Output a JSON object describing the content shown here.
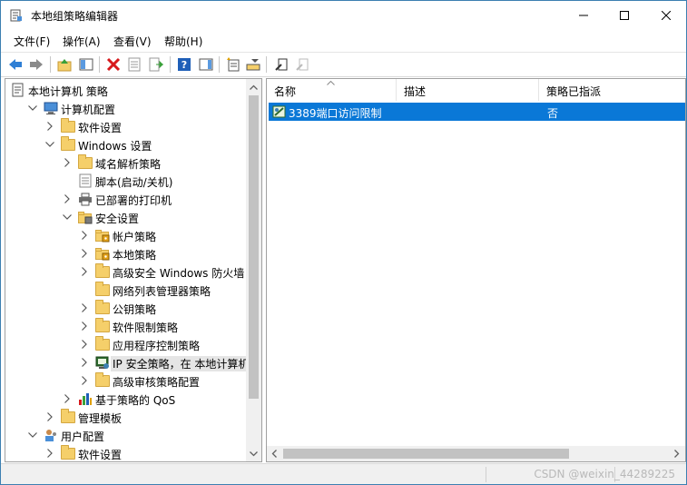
{
  "window": {
    "title": "本地组策略编辑器"
  },
  "menu": [
    {
      "label": "文件(F)"
    },
    {
      "label": "操作(A)"
    },
    {
      "label": "查看(V)"
    },
    {
      "label": "帮助(H)"
    }
  ],
  "toolbar": {
    "buttons": [
      {
        "icon": "back-arrow-icon"
      },
      {
        "icon": "forward-arrow-icon"
      },
      {
        "icon": "up-folder-icon"
      },
      {
        "icon": "show-hide-tree-icon"
      },
      {
        "icon": "delete-icon"
      },
      {
        "icon": "properties-icon"
      },
      {
        "icon": "export-list-icon"
      },
      {
        "icon": "help-icon"
      },
      {
        "icon": "action-pane-icon"
      },
      {
        "icon": "new-policy-icon"
      },
      {
        "icon": "manage-filters-icon"
      },
      {
        "icon": "assign-policy-icon"
      },
      {
        "icon": "unassign-policy-icon"
      }
    ]
  },
  "tree": [
    {
      "label": "本地计算机 策略",
      "icon": "policy-doc-icon",
      "expander": "none"
    },
    {
      "label": "计算机配置",
      "icon": "computer-icon",
      "expander": "expanded"
    },
    {
      "label": "软件设置",
      "icon": "folder-icon",
      "expander": "collapsed"
    },
    {
      "label": "Windows 设置",
      "icon": "folder-icon",
      "expander": "expanded"
    },
    {
      "label": "域名解析策略",
      "icon": "folder-icon",
      "expander": "collapsed"
    },
    {
      "label": "脚本(启动/关机)",
      "icon": "script-icon",
      "expander": "none"
    },
    {
      "label": "已部署的打印机",
      "icon": "printer-icon",
      "expander": "collapsed"
    },
    {
      "label": "安全设置",
      "icon": "security-folder-icon",
      "expander": "expanded"
    },
    {
      "label": "帐户策略",
      "icon": "lock-folder-icon",
      "expander": "collapsed"
    },
    {
      "label": "本地策略",
      "icon": "lock-folder-icon",
      "expander": "collapsed"
    },
    {
      "label": "高级安全 Windows 防火墙",
      "icon": "folder-icon",
      "expander": "collapsed"
    },
    {
      "label": "网络列表管理器策略",
      "icon": "folder-icon",
      "expander": "none"
    },
    {
      "label": "公钥策略",
      "icon": "folder-icon",
      "expander": "collapsed"
    },
    {
      "label": "软件限制策略",
      "icon": "folder-icon",
      "expander": "collapsed"
    },
    {
      "label": "应用程序控制策略",
      "icon": "folder-icon",
      "expander": "collapsed"
    },
    {
      "label": "IP 安全策略，在 本地计算机",
      "icon": "ipsec-icon",
      "expander": "collapsed",
      "selected": true
    },
    {
      "label": "高级审核策略配置",
      "icon": "folder-icon",
      "expander": "collapsed"
    },
    {
      "label": "基于策略的 QoS",
      "icon": "qos-chart-icon",
      "expander": "collapsed"
    },
    {
      "label": "管理模板",
      "icon": "folder-icon",
      "expander": "collapsed"
    },
    {
      "label": "用户配置",
      "icon": "user-icon",
      "expander": "expanded"
    },
    {
      "label": "软件设置",
      "icon": "folder-icon",
      "expander": "collapsed"
    }
  ],
  "list": {
    "columns": [
      {
        "label": "名称"
      },
      {
        "label": "描述"
      },
      {
        "label": "策略已指派"
      }
    ],
    "rows": [
      {
        "name": "3389端口访问限制",
        "description": "",
        "assigned": "否"
      }
    ]
  },
  "status": {
    "watermark": "CSDN @weixin_44289225"
  },
  "colors": {
    "selection": "#0a78d7",
    "folder": "#f5cf6a"
  }
}
